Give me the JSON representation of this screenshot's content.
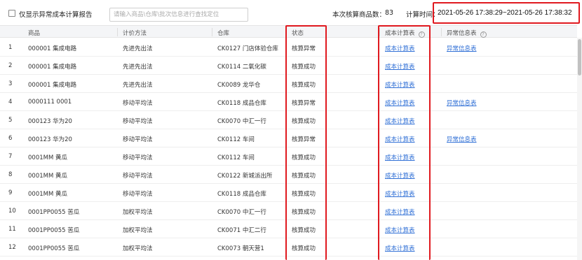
{
  "toolbar": {
    "only_exception_label": "仅显示异常成本计算报告",
    "search_placeholder": "请输入商品\\仓库\\批次信息进行查找定位",
    "count_label": "本次核算商品数：",
    "count_value": "83",
    "time_label": "计算时间：",
    "time_value": "2021-05-26 17:38:29~2021-05-26 17:38:32"
  },
  "table": {
    "headers": {
      "goods": "商品",
      "method": "计价方法",
      "warehouse": "仓库",
      "status": "状态",
      "cost": "成本计算表",
      "exception": "异常信息表"
    },
    "rows": [
      {
        "idx": "1",
        "goods": "000001 集成电路",
        "method": "先进先出法",
        "warehouse": "CK0127 门店体验仓库",
        "status": "核算异常",
        "cost": "成本计算表",
        "exception": "异常信息表"
      },
      {
        "idx": "2",
        "goods": "000001 集成电路",
        "method": "先进先出法",
        "warehouse": "CK0114 二氧化碳",
        "status": "核算成功",
        "cost": "成本计算表",
        "exception": ""
      },
      {
        "idx": "3",
        "goods": "000001 集成电路",
        "method": "先进先出法",
        "warehouse": "CK0089 龙华仓",
        "status": "核算成功",
        "cost": "成本计算表",
        "exception": ""
      },
      {
        "idx": "4",
        "goods": "0000111 0001",
        "method": "移动平均法",
        "warehouse": "CK0118 成品仓库",
        "status": "核算异常",
        "cost": "成本计算表",
        "exception": "异常信息表"
      },
      {
        "idx": "5",
        "goods": "000123 华为20",
        "method": "移动平均法",
        "warehouse": "CK0070 中汇一行",
        "status": "核算成功",
        "cost": "成本计算表",
        "exception": ""
      },
      {
        "idx": "6",
        "goods": "000123 华为20",
        "method": "移动平均法",
        "warehouse": "CK0112 车间",
        "status": "核算异常",
        "cost": "成本计算表",
        "exception": "异常信息表"
      },
      {
        "idx": "7",
        "goods": "0001MM 黄瓜",
        "method": "移动平均法",
        "warehouse": "CK0112 车间",
        "status": "核算成功",
        "cost": "成本计算表",
        "exception": ""
      },
      {
        "idx": "8",
        "goods": "0001MM 黄瓜",
        "method": "移动平均法",
        "warehouse": "CK0122 新城派出所",
        "status": "核算成功",
        "cost": "成本计算表",
        "exception": ""
      },
      {
        "idx": "9",
        "goods": "0001MM 黄瓜",
        "method": "移动平均法",
        "warehouse": "CK0118 成品仓库",
        "status": "核算成功",
        "cost": "成本计算表",
        "exception": ""
      },
      {
        "idx": "10",
        "goods": "0001PP0055 苦瓜",
        "method": "加权平均法",
        "warehouse": "CK0070 中汇一行",
        "status": "核算成功",
        "cost": "成本计算表",
        "exception": ""
      },
      {
        "idx": "11",
        "goods": "0001PP0055 苦瓜",
        "method": "加权平均法",
        "warehouse": "CK0071 中汇二行",
        "status": "核算成功",
        "cost": "成本计算表",
        "exception": ""
      },
      {
        "idx": "12",
        "goods": "0001PP0055 苦瓜",
        "method": "加权平均法",
        "warehouse": "CK0073 朝天营1",
        "status": "核算成功",
        "cost": "成本计算表",
        "exception": ""
      }
    ]
  },
  "icons": {
    "cost_help": "help-circle-icon",
    "exception_help": "help-circle-icon",
    "checkbox": "checkbox-icon"
  },
  "colors": {
    "link": "#2f6fd6",
    "highlight": "#e0191f",
    "header_bg": "#f4f5f7"
  }
}
